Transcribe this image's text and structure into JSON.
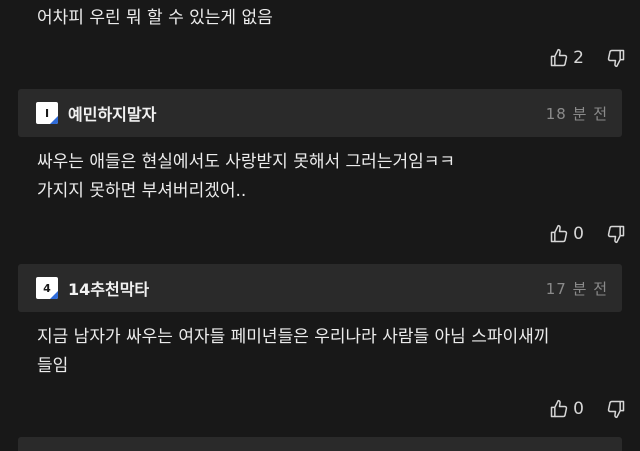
{
  "top_comment": {
    "text": "어차피 우린 뭐 할 수 있는게 없음",
    "likes": "2"
  },
  "comments": [
    {
      "level": "I",
      "nickname": "예민하지말자",
      "time": "18 분 전",
      "text": "싸우는 애들은 현실에서도 사랑받지 못해서 그러는거임ㅋㅋ\n가지지 못하면 부셔버리겠어..",
      "likes": "0"
    },
    {
      "level": "4",
      "nickname": "14추천막타",
      "time": "17 분 전",
      "text": "지금 남자가 싸우는 여자들 페미년들은 우리나라 사람들 아님 스파이새끼\n들임",
      "likes": "0"
    }
  ],
  "icons": {
    "like": "thumbs-up-icon",
    "dislike": "thumbs-down-icon",
    "level_badge": "level-badge-icon"
  },
  "colors": {
    "background": "#181818",
    "header_bg": "#2a2a2a",
    "badge_accent": "#2f6bd8",
    "time_text": "#8a8a8a"
  }
}
